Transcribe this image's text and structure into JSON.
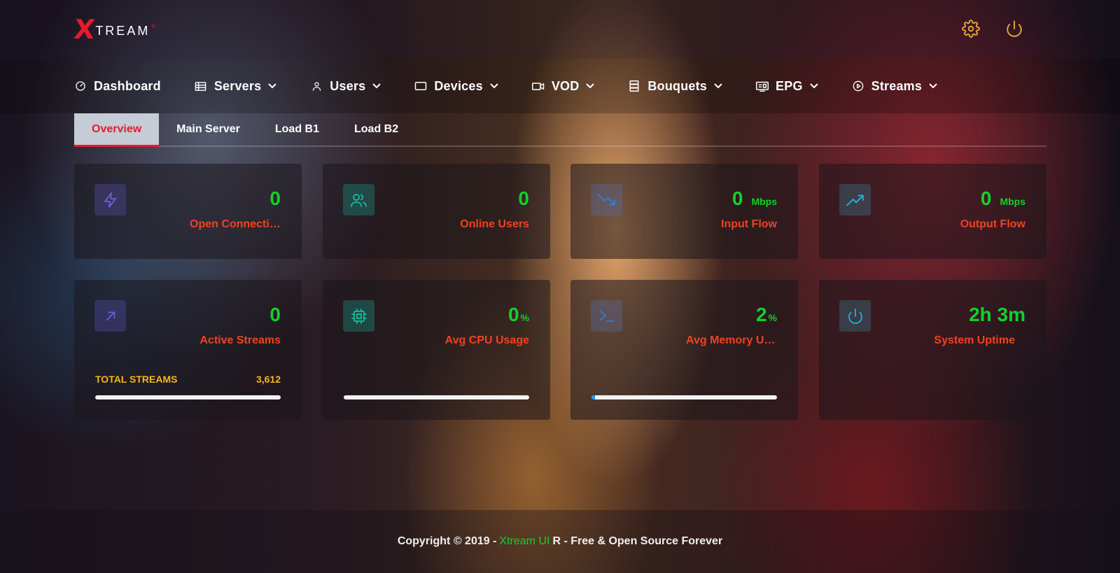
{
  "app": {
    "logo_x": "X",
    "logo_rest": "TREAM",
    "logo_mark": "®"
  },
  "header_icons": [
    "gear-icon",
    "power-icon"
  ],
  "nav": {
    "items": [
      {
        "label": "Dashboard",
        "icon": "gauge-icon",
        "dropdown": false
      },
      {
        "label": "Servers",
        "icon": "server-list-icon",
        "dropdown": true
      },
      {
        "label": "Users",
        "icon": "user-icon",
        "dropdown": true
      },
      {
        "label": "Devices",
        "icon": "tablet-icon",
        "dropdown": true
      },
      {
        "label": "VOD",
        "icon": "video-icon",
        "dropdown": true
      },
      {
        "label": "Bouquets",
        "icon": "database-icon",
        "dropdown": true
      },
      {
        "label": "EPG",
        "icon": "guide-icon",
        "dropdown": true
      },
      {
        "label": "Streams",
        "icon": "play-circle-icon",
        "dropdown": true
      }
    ]
  },
  "tabs": [
    {
      "label": "Overview",
      "active": true
    },
    {
      "label": "Main Server",
      "active": false
    },
    {
      "label": "Load B1",
      "active": false
    },
    {
      "label": "Load B2",
      "active": false
    }
  ],
  "cards": {
    "open_connections": {
      "value": "0",
      "caption": "Open Connections",
      "icon": "bolt-icon"
    },
    "online_users": {
      "value": "0",
      "caption": "Online Users",
      "icon": "users-icon"
    },
    "input_flow": {
      "value": "0",
      "unit": "Mbps",
      "caption": "Input Flow",
      "icon": "trending-down-icon"
    },
    "output_flow": {
      "value": "0",
      "unit": "Mbps",
      "caption": "Output Flow",
      "icon": "trending-up-icon"
    },
    "active_streams": {
      "value": "0",
      "caption": "Active Streams",
      "icon": "arrow-up-right-icon",
      "total_label": "TOTAL STREAMS",
      "total_value": "3,612",
      "progress": 0
    },
    "avg_cpu": {
      "value": "0",
      "unit": "%",
      "caption": "Avg CPU Usage",
      "icon": "cpu-icon",
      "progress": 0
    },
    "avg_memory": {
      "value": "2",
      "unit": "%",
      "caption": "Avg Memory Usage",
      "icon": "terminal-icon",
      "progress": 0.02
    },
    "system_uptime": {
      "value": "2h 3m",
      "caption": "System Uptime",
      "icon": "power-icon"
    }
  },
  "footer": {
    "prefix": "Copyright © 2019 -",
    "brand": "Xtream UI",
    "suffix": "R - Free & Open Source Forever"
  },
  "colors": {
    "accent_red": "#e8192c",
    "value_green": "#12d12a",
    "caption_orange": "#f0431e",
    "totals_yellow": "#f4b71a",
    "icon_orange": "#e8a13a"
  }
}
